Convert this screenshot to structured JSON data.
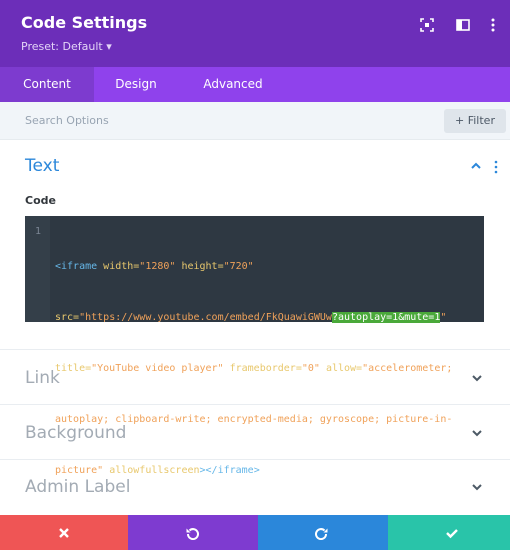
{
  "header": {
    "title": "Code Settings",
    "preset": "Preset: Default ▾",
    "icons": [
      "expand-icon",
      "columns-icon",
      "kebab-menu-icon"
    ],
    "color": "#6c2eb9"
  },
  "tabs": [
    {
      "label": "Content",
      "active": true
    },
    {
      "label": "Design",
      "active": false
    },
    {
      "label": "Advanced",
      "active": false
    }
  ],
  "search": {
    "placeholder": "Search Options",
    "filter_label": "+ Filter"
  },
  "sections": {
    "text": {
      "title": "Text",
      "expanded": true
    },
    "link": {
      "title": "Link",
      "expanded": false
    },
    "background": {
      "title": "Background",
      "expanded": false
    },
    "admin_label": {
      "title": "Admin Label",
      "expanded": false
    }
  },
  "code_field": {
    "label": "Code",
    "line_number": "1",
    "lines": [
      {
        "tag_open": "<iframe ",
        "attr1": "width=",
        "val1": "\"1280\"",
        "attr2": " height=",
        "val2": "\"720\""
      },
      {
        "attr": "src=",
        "val_start": "\"https://www.youtube.com/embed/FkQuawiGWUw",
        "highlighted": "?autoplay=1&mute=1",
        "val_end": "\""
      },
      {
        "attr1": "title=",
        "val1": "\"YouTube video player\"",
        "attr2": " frameborder=",
        "val2": "\"0\"",
        "attr3": " allow=",
        "val3": "\"accelerometer;"
      },
      {
        "val": "autoplay; clipboard-write; encrypted-media; gyroscope; picture-in-"
      },
      {
        "val": "picture\"",
        "attr": " allowfullscreen",
        "tag_end": ">",
        "close_tag": "</iframe>"
      }
    ]
  },
  "footer": {
    "buttons": [
      {
        "name": "cancel",
        "icon": "close-icon",
        "color": "#ef5555"
      },
      {
        "name": "undo",
        "icon": "undo-icon",
        "color": "#7e3bd0"
      },
      {
        "name": "redo",
        "icon": "redo-icon",
        "color": "#2b87da"
      },
      {
        "name": "save",
        "icon": "check-icon",
        "color": "#29c4a9"
      }
    ]
  },
  "colors": {
    "accent": "#2b87da",
    "tab_bar": "#8f42ec",
    "active_tab": "#7d3bcf",
    "editor_bg": "#2e3842"
  }
}
